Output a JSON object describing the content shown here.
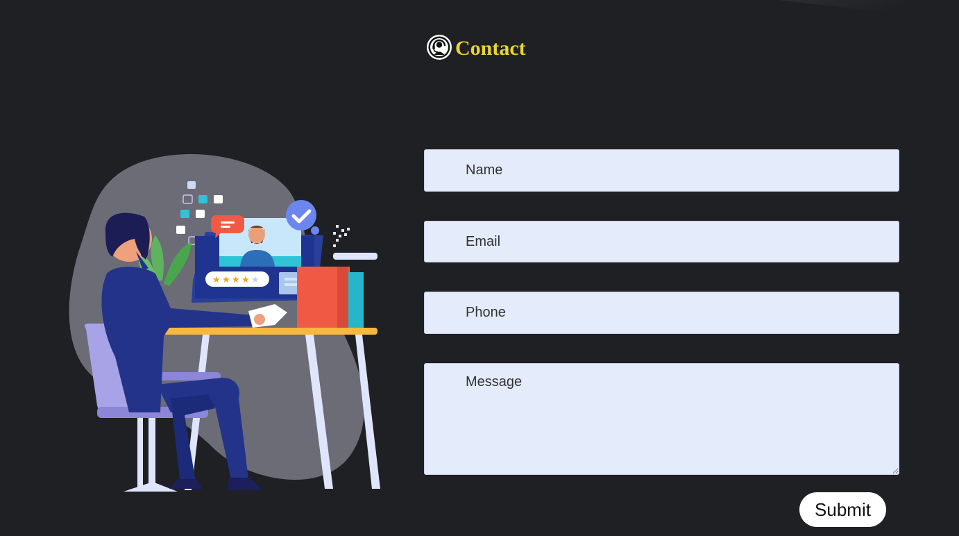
{
  "header": {
    "title": "Contact",
    "icon": "headset-support-icon"
  },
  "illustration": {
    "subject": "customer-support-agent-at-desk",
    "rating_stars": 4,
    "rating_max": 5
  },
  "form": {
    "name_placeholder": "Name",
    "email_placeholder": "Email",
    "phone_placeholder": "Phone",
    "message_placeholder": "Message",
    "submit_label": "Submit"
  },
  "colors": {
    "background": "#1f2024",
    "title": "#e8d630",
    "field_bg": "#e4ebfb",
    "button_bg": "#ffffff"
  }
}
